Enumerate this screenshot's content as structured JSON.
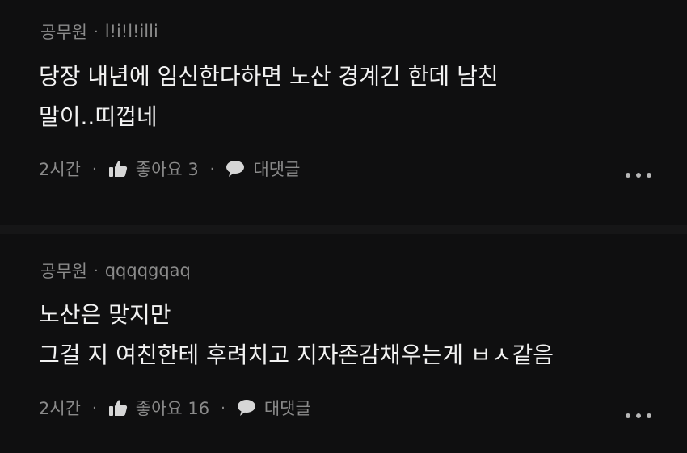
{
  "comments": [
    {
      "category": "공무원",
      "username": "l!i!l!illi",
      "lines": [
        "당장 내년에 임신한다하면 노산 경계긴 한데 남친",
        "말이..띠껍네"
      ],
      "time": "2시간",
      "like_label": "좋아요 3",
      "reply_label": "대댓글"
    },
    {
      "category": "공무원",
      "username": "qqqqgqaq",
      "lines": [
        "노산은 맞지만",
        "그걸 지 여친한테 후려치고 지자존감채우는게 ㅂㅅ같음"
      ],
      "time": "2시간",
      "like_label": "좋아요 16",
      "reply_label": "대댓글"
    }
  ],
  "separator": "·",
  "icons": {
    "like": "thumbs-up-icon",
    "reply": "speech-bubble-icon",
    "more": "more-dots-icon"
  },
  "colors": {
    "background": "#0f0f10",
    "text": "#f2f2f2",
    "muted": "#8a8a8a"
  }
}
